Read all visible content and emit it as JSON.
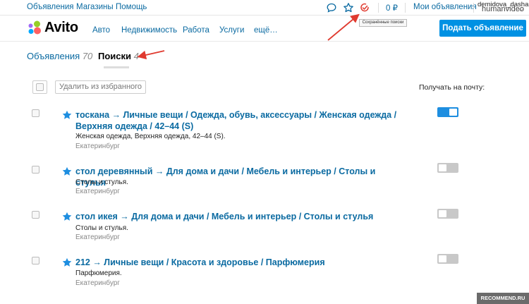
{
  "topbar": {
    "links": [
      "Объявления",
      "Магазины",
      "Помощь"
    ],
    "balance": "0 ₽",
    "my_ads": "Мои объявления",
    "user_name": "demidova_dasha",
    "account_name": "humanvideo"
  },
  "tooltip": "Сохранённые поиски",
  "header": {
    "logo": "Avito",
    "nav": [
      "Авто",
      "Недвижимость",
      "Работа",
      "Услуги",
      "ещё…"
    ],
    "post_button": "Подать объявление"
  },
  "tabs": [
    {
      "label": "Объявления",
      "count": "70"
    },
    {
      "label": "Поиски",
      "count": "4"
    }
  ],
  "toolbar": {
    "remove_button": "Удалить из избранного",
    "receive_label": "Получать на почту:"
  },
  "rows": [
    {
      "title_line1": "тоскана → Личные вещи / Одежда, обувь, аксессуары / Женская одежда /",
      "title_line2": "Верхняя одежда / 42–44 (S)",
      "description": "Женская одежда, Верхняя одежда, 42–44 (S).",
      "city": "Екатеринбург",
      "email_enabled": true
    },
    {
      "title_line1": "стол деревянный → Для дома и дачи / Мебель и интерьер / Столы и стулья",
      "description": "Столы и стулья.",
      "city": "Екатеринбург",
      "email_enabled": false
    },
    {
      "title_line1": "стол икея → Для дома и дачи / Мебель и интерьер / Столы и стулья",
      "description": "Столы и стулья.",
      "city": "Екатеринбург",
      "email_enabled": false
    },
    {
      "title_line1": "212 → Личные вещи / Красота и здоровье / Парфюмерия",
      "description": "Парфюмерия.",
      "city": "Екатеринбург",
      "email_enabled": false
    }
  ],
  "watermark": "RECOMMEND.RU",
  "colors": {
    "link": "#0a6aa1",
    "primary_button": "#0091e3",
    "toggle_on": "#1e8ee0",
    "toggle_off": "#c8c8c8",
    "annotation_arrow": "#e03a2f",
    "star": "#1e8ee0"
  }
}
